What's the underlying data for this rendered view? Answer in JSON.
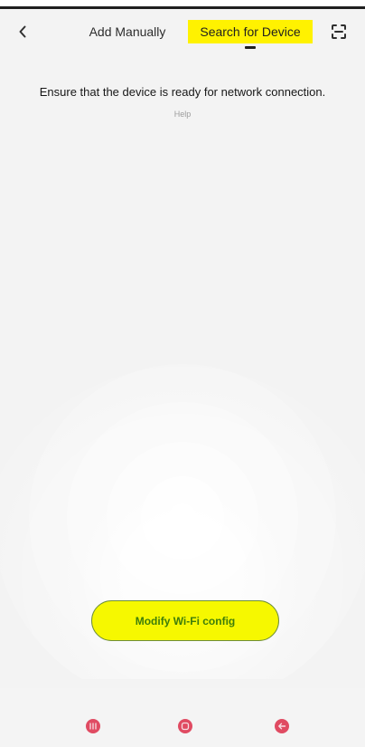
{
  "header": {
    "back_icon": "chevron-left-icon",
    "tabs": [
      {
        "label": "Add Manually",
        "active": false
      },
      {
        "label": "Search for Device",
        "active": true
      }
    ],
    "scan_icon": "scan-frame-icon"
  },
  "main": {
    "instruction": "Ensure that the device is ready for network connection.",
    "help_label": "Help",
    "primary_button_label": "Modify Wi-Fi config"
  },
  "bottom_nav": {
    "recent_icon": "recent-apps-icon",
    "home_icon": "home-icon",
    "back_icon": "back-icon"
  },
  "colors": {
    "highlight": "#fff200",
    "button_text": "#3d7d0b",
    "nav_icon": "#e04b62",
    "background": "#f3f3f3"
  }
}
